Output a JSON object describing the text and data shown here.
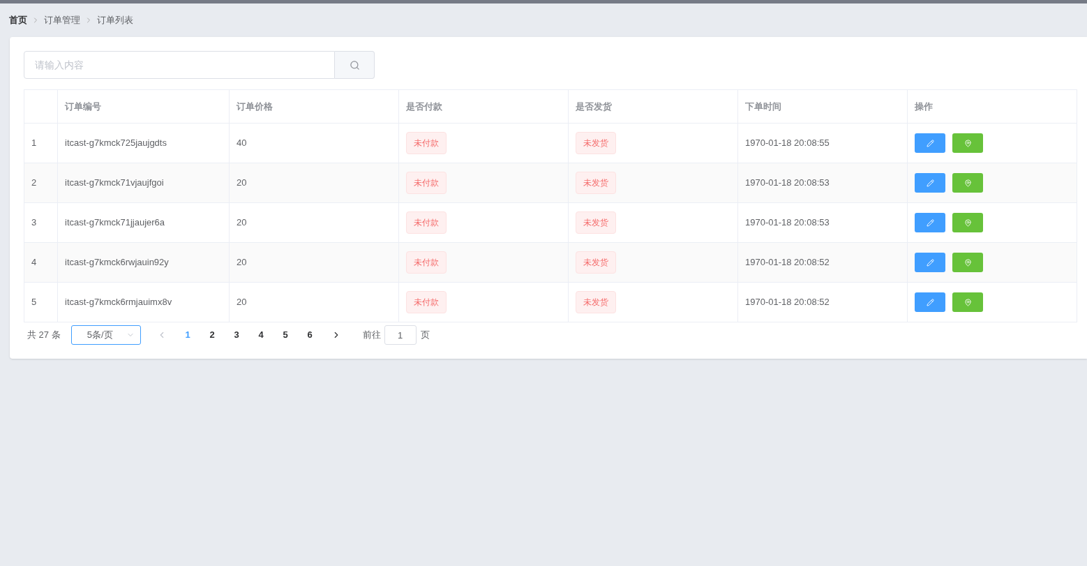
{
  "breadcrumb": [
    {
      "label": "首页",
      "current": false
    },
    {
      "label": "订单管理",
      "current": true
    },
    {
      "label": "订单列表",
      "current": true
    }
  ],
  "search": {
    "placeholder": "请输入内容"
  },
  "table": {
    "columns": [
      "订单编号",
      "订单价格",
      "是否付款",
      "是否发货",
      "下单时间",
      "操作"
    ],
    "rows": [
      {
        "index": "1",
        "order_no": "itcast-g7kmck725jaujgdts",
        "price": "40",
        "paid": "未付款",
        "shipped": "未发货",
        "time": "1970-01-18 20:08:55"
      },
      {
        "index": "2",
        "order_no": "itcast-g7kmck71vjaujfgoi",
        "price": "20",
        "paid": "未付款",
        "shipped": "未发货",
        "time": "1970-01-18 20:08:53"
      },
      {
        "index": "3",
        "order_no": "itcast-g7kmck71jjaujer6a",
        "price": "20",
        "paid": "未付款",
        "shipped": "未发货",
        "time": "1970-01-18 20:08:53"
      },
      {
        "index": "4",
        "order_no": "itcast-g7kmck6rwjauin92y",
        "price": "20",
        "paid": "未付款",
        "shipped": "未发货",
        "time": "1970-01-18 20:08:52"
      },
      {
        "index": "5",
        "order_no": "itcast-g7kmck6rmjauimx8v",
        "price": "20",
        "paid": "未付款",
        "shipped": "未发货",
        "time": "1970-01-18 20:08:52"
      }
    ]
  },
  "pagination": {
    "total": "共 27 条",
    "page_size": "5条/页",
    "prev_disabled": true,
    "pages": [
      {
        "label": "1",
        "selected": true
      },
      {
        "label": "2",
        "selected": false
      },
      {
        "label": "3",
        "selected": false
      },
      {
        "label": "4",
        "selected": false
      },
      {
        "label": "5",
        "selected": false
      },
      {
        "label": "6",
        "selected": false
      }
    ],
    "jump_label": "前往",
    "jump_value": "1",
    "jump_suffix": "页"
  }
}
